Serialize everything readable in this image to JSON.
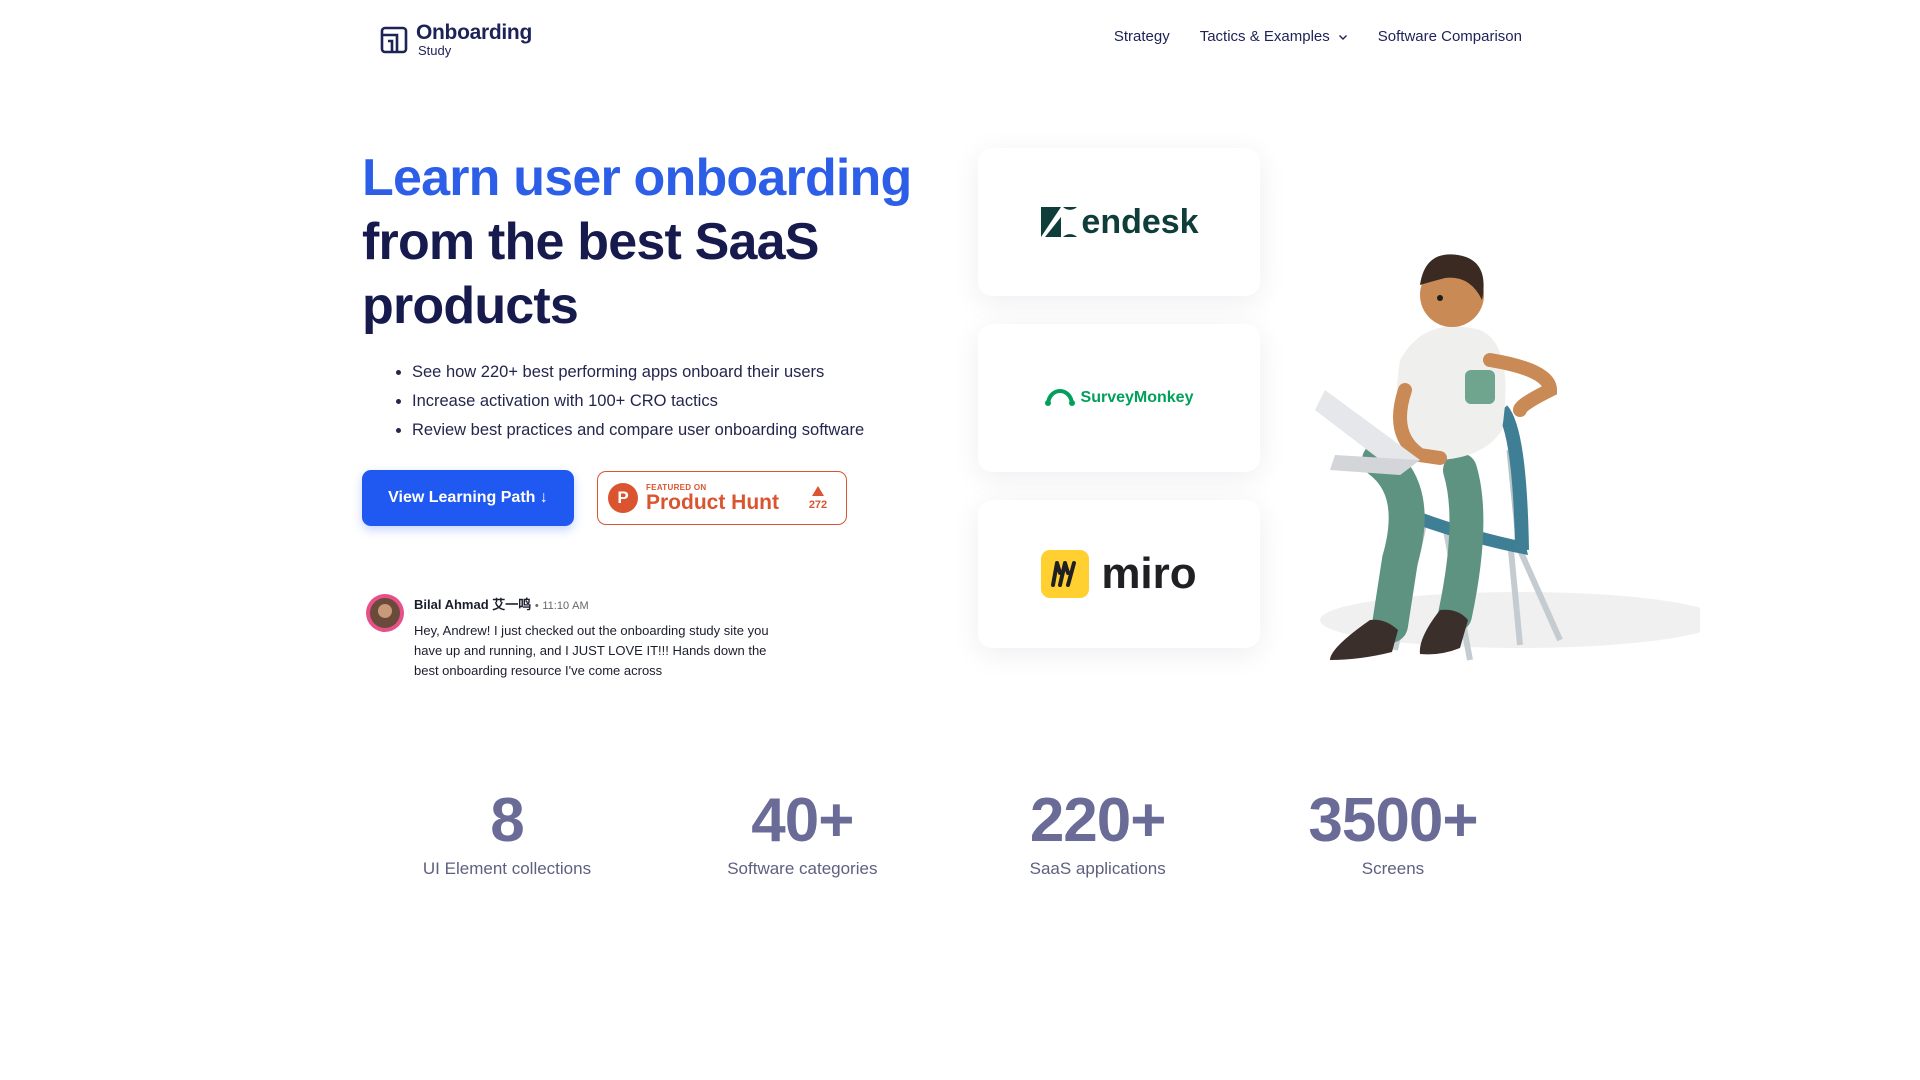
{
  "header": {
    "logo_title": "Onboarding",
    "logo_subtitle": "Study",
    "nav": [
      "Strategy",
      "Tactics & Examples",
      "Software Comparison"
    ]
  },
  "hero": {
    "title_accent": "Learn user onboarding",
    "title_rest": "from the best SaaS products",
    "bullets": [
      "See how 220+ best performing apps onboard their users",
      "Increase activation with 100+ CRO tactics",
      "Review best practices and compare user onboarding software"
    ],
    "cta_label": "View Learning Path ↓",
    "producthunt": {
      "featured": "FEATURED ON",
      "name": "Product Hunt",
      "votes": "272"
    }
  },
  "testimonial": {
    "name": "Bilal Ahmad 艾一鸣",
    "separator": "•",
    "time": "11:10 AM",
    "message": "Hey, Andrew! I just checked out the onboarding study site you have up and running, and I JUST LOVE IT!!! Hands down the best onboarding resource I've come across"
  },
  "brands": {
    "zendesk": "endesk",
    "surveymonkey": "SurveyMonkey",
    "miro": "miro"
  },
  "stats": [
    {
      "value": "8",
      "label": "UI Element collections"
    },
    {
      "value": "40+",
      "label": "Software categories"
    },
    {
      "value": "220+",
      "label": "SaaS applications"
    },
    {
      "value": "3500+",
      "label": "Screens"
    }
  ],
  "colors": {
    "accent": "#2d5ee8",
    "button": "#2058f2",
    "producthunt": "#da552f",
    "heading": "#161a4d",
    "stat": "#6a6c97"
  }
}
